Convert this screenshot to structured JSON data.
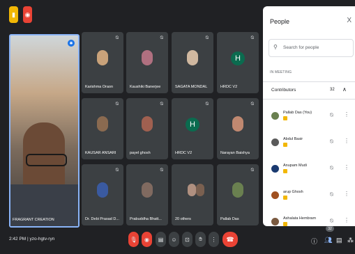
{
  "top": {
    "yellow_icon": "notes-icon",
    "red_icon": "record-icon"
  },
  "self_tile": {
    "label": "FRAGRANT CREATION"
  },
  "tiles": [
    {
      "name": "Karishma Oraon",
      "avatar": "photo",
      "color": "#c9a27a"
    },
    {
      "name": "Kaushiki Banerjee",
      "avatar": "photo",
      "color": "#b07080"
    },
    {
      "name": "SAGATA MONDAL",
      "avatar": "photo",
      "color": "#d0b8a0"
    },
    {
      "name": "HRDC V2",
      "avatar": "H",
      "color": "#0b6b4f"
    },
    {
      "name": "KAUSAR ANSARI",
      "avatar": "photo",
      "color": "#8a6a50"
    },
    {
      "name": "payel ghosh",
      "avatar": "photo",
      "color": "#a06050"
    },
    {
      "name": "HRDC V2",
      "avatar": "H",
      "color": "#0b6b4f"
    },
    {
      "name": "Narayan Baishya",
      "avatar": "photo",
      "color": "#c08870"
    },
    {
      "name": "Dr. Debi Prasad D...",
      "avatar": "photo",
      "color": "#3a5aa0"
    },
    {
      "name": "Prabuddha Bhatt...",
      "avatar": "photo",
      "color": "#806a60"
    },
    {
      "name": "20 others",
      "avatar": "group",
      "color": "#b09080"
    },
    {
      "name": "Pallab Das",
      "avatar": "photo",
      "color": "#6a8050"
    }
  ],
  "bottom": {
    "time": "2:42 PM",
    "separator": "|",
    "meeting_code": "yzo-hgtv-ryn",
    "people_count": "32"
  },
  "panel": {
    "title": "People",
    "close": "X",
    "search_placeholder": "Search for people",
    "in_meeting": "IN MEETING",
    "contributors_label": "Contributors",
    "contributors_count": "32",
    "participants": [
      {
        "name": "Pallab Das (You)",
        "color": "#6a8050"
      },
      {
        "name": "Abdul Basir",
        "color": "#5a5a5a"
      },
      {
        "name": "Anupam Mudi",
        "color": "#1a3a70"
      },
      {
        "name": "arup Ghosh",
        "color": "#a05020"
      },
      {
        "name": "Ashalata Hembram",
        "color": "#7a5a40"
      }
    ]
  }
}
